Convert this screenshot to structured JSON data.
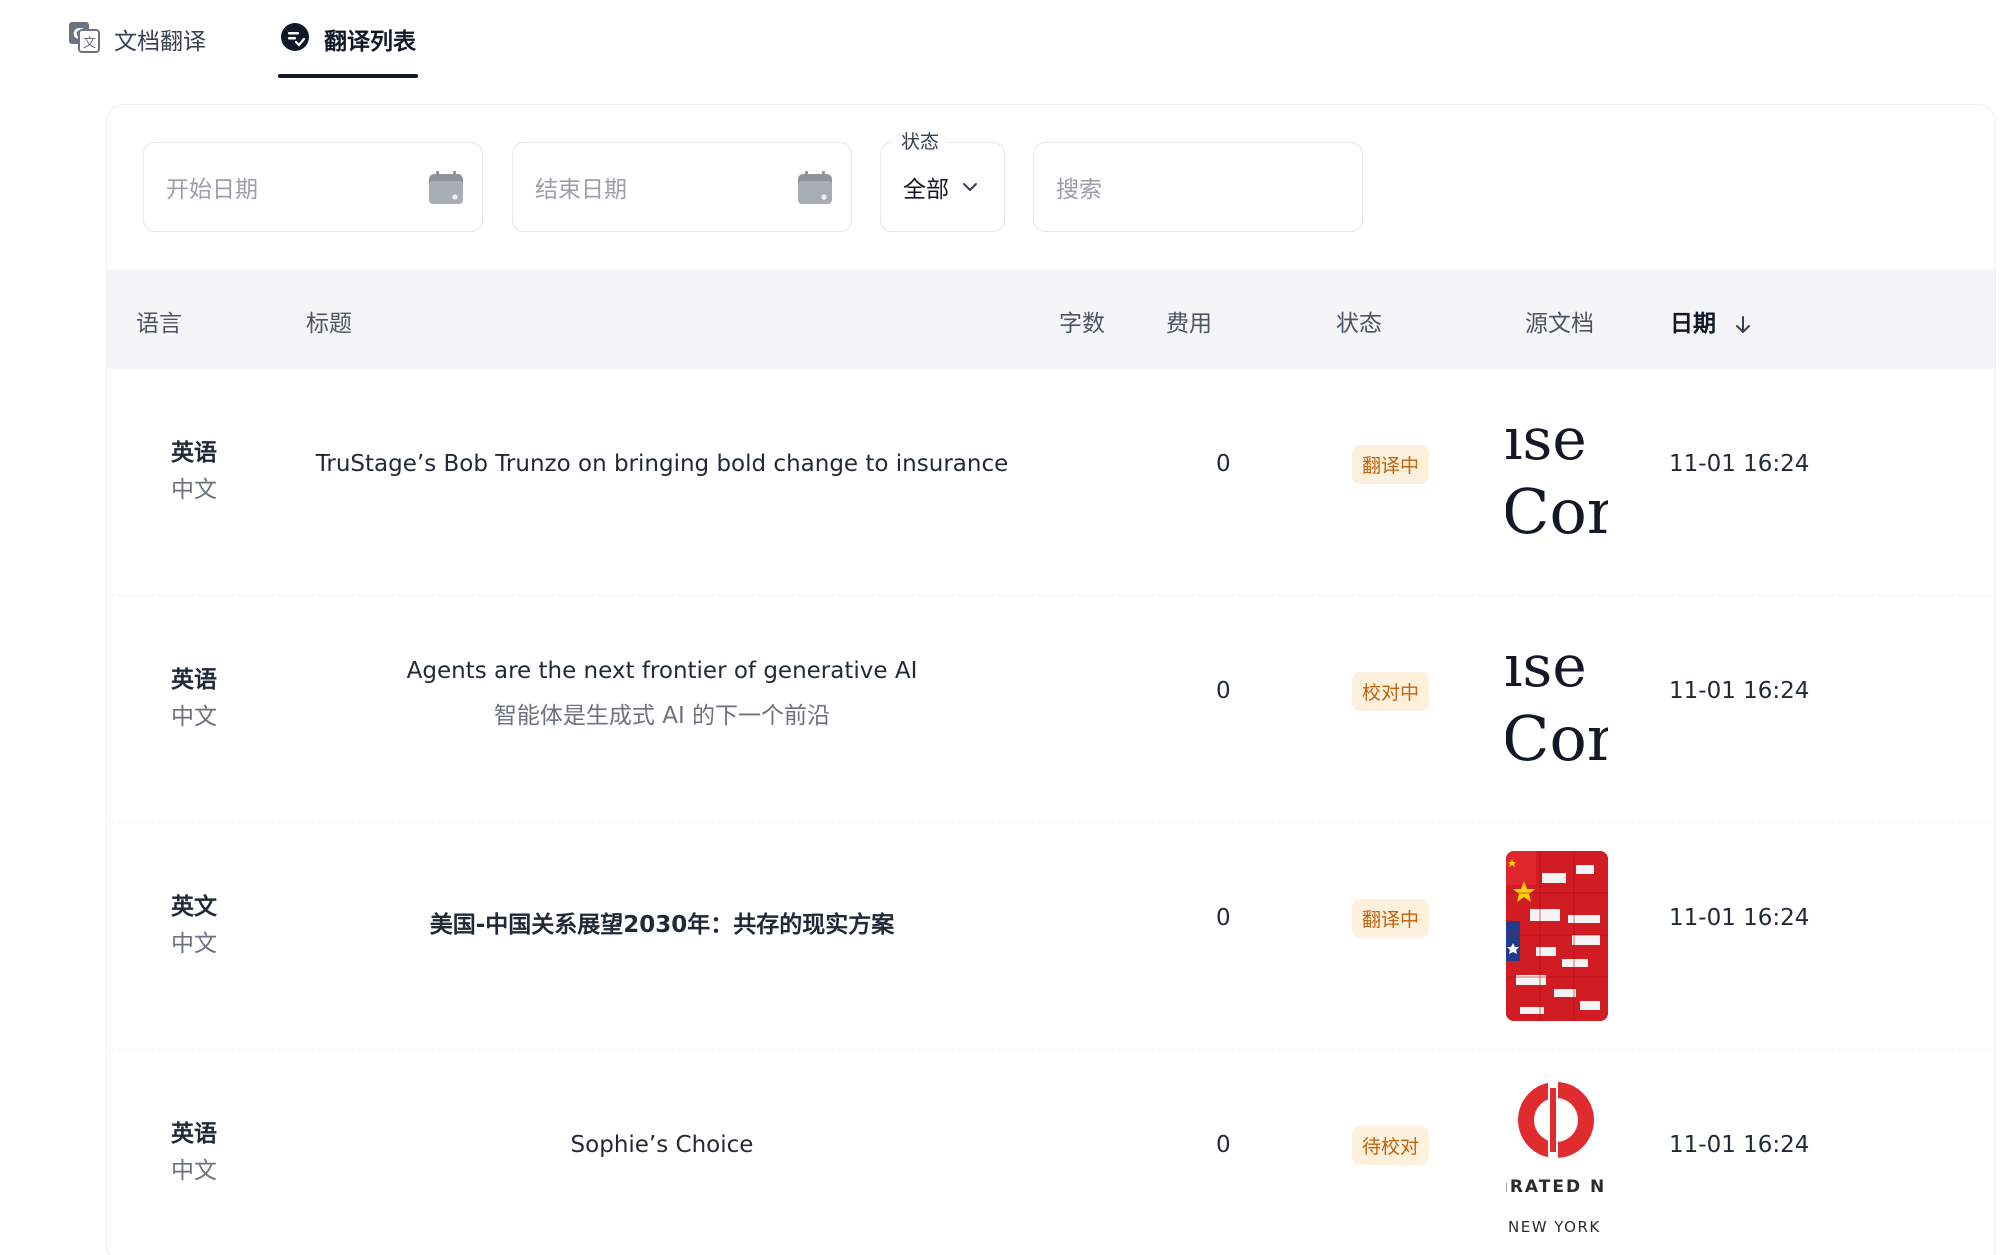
{
  "tabs": [
    {
      "label": "文档翻译",
      "icon": "translate-icon",
      "active": false
    },
    {
      "label": "翻译列表",
      "icon": "list-icon",
      "active": true
    }
  ],
  "filters": {
    "start_date_placeholder": "开始日期",
    "end_date_placeholder": "结束日期",
    "status_legend": "状态",
    "status_value": "全部",
    "search_placeholder": "搜索"
  },
  "table": {
    "headers": {
      "language": "语言",
      "title": "标题",
      "words": "字数",
      "cost": "费用",
      "status": "状态",
      "source": "源文档",
      "date": "日期"
    },
    "rows": [
      {
        "lang_src": "英语",
        "lang_tgt": "中文",
        "title": "TruStage’s Bob Trunzo on bringing bold change to insurance",
        "subtitle": "",
        "words": "0",
        "status": "翻译中",
        "thumb_text": [
          "ıse",
          "Cor"
        ],
        "date": "11-01 16:24"
      },
      {
        "lang_src": "英语",
        "lang_tgt": "中文",
        "title": "Agents are the next frontier of generative AI",
        "subtitle": "智能体是生成式 AI 的下一个前沿",
        "words": "0",
        "status": "校对中",
        "thumb_text": [
          "ıse",
          "Cor"
        ],
        "date": "11-01 16:24"
      },
      {
        "lang_src": "英文",
        "lang_tgt": "中文",
        "title": "美国-中国关系展望2030年：共存的现实方案",
        "subtitle": "",
        "words": "0",
        "status": "翻译中",
        "thumb_text": [],
        "date": "11-01 16:24"
      },
      {
        "lang_src": "英语",
        "lang_tgt": "中文",
        "title": "Sophie’s Choice",
        "subtitle": "",
        "words": "0",
        "status": "待校对",
        "thumb_text": [
          "ıRATED N",
          "NEW YORK"
        ],
        "date": "11-01 16:24"
      }
    ]
  },
  "colors": {
    "badge_text": "#c2620c",
    "badge_bg": "#fdf0dc",
    "header_bg": "#f4f5f7",
    "active_tab": "#111827"
  }
}
